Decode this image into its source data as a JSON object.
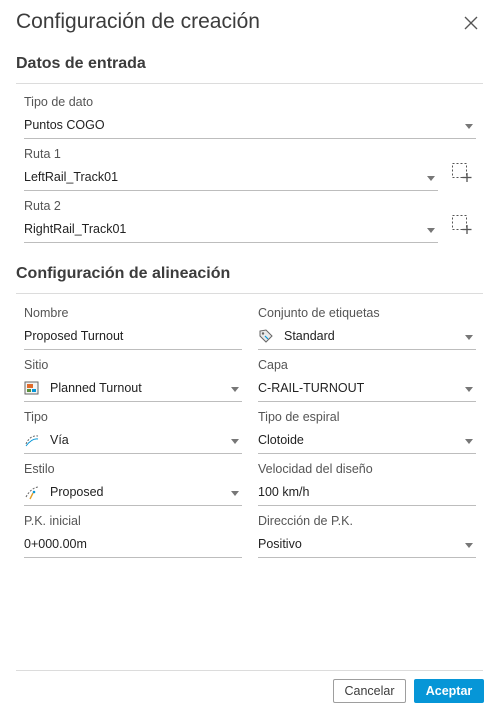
{
  "dialog": {
    "title": "Configuración de creación"
  },
  "input_section": {
    "title": "Datos de entrada",
    "fields": {
      "data_type": {
        "label": "Tipo de dato",
        "value": "Puntos COGO"
      },
      "route1": {
        "label": "Ruta 1",
        "value": "LeftRail_Track01"
      },
      "route2": {
        "label": "Ruta 2",
        "value": "RightRail_Track01"
      }
    }
  },
  "alignment_section": {
    "title": "Configuración de alineación",
    "fields": {
      "name": {
        "label": "Nombre",
        "value": "Proposed Turnout"
      },
      "label_set": {
        "label": "Conjunto de etiquetas",
        "value": "Standard"
      },
      "site": {
        "label": "Sitio",
        "value": "Planned Turnout"
      },
      "layer": {
        "label": "Capa",
        "value": "C-RAIL-TURNOUT"
      },
      "type": {
        "label": "Tipo",
        "value": "Vía"
      },
      "spiral_type": {
        "label": "Tipo de espiral",
        "value": "Clotoide"
      },
      "style": {
        "label": "Estilo",
        "value": "Proposed"
      },
      "design_speed": {
        "label": "Velocidad del diseño",
        "value": "100 km/h"
      },
      "start_station": {
        "label": "P.K. inicial",
        "value": "0+000.00m"
      },
      "station_direction": {
        "label": "Dirección de P.K.",
        "value": "Positivo"
      }
    }
  },
  "footer": {
    "cancel_label": "Cancelar",
    "accept_label": "Aceptar"
  },
  "colors": {
    "accent": "#0696d7",
    "rule": "#dcdcdc",
    "text": "#3c3c3c"
  }
}
